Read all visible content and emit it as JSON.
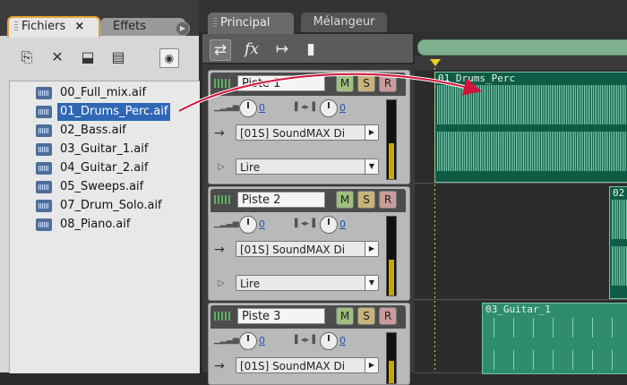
{
  "files_panel": {
    "tab_files": "Fichiers",
    "tab_effects": "Effets",
    "close_glyph": "×",
    "items": [
      {
        "name": "00_Full_mix.aif",
        "selected": false
      },
      {
        "name": "01_Drums_Perc.aif",
        "selected": true
      },
      {
        "name": "02_Bass.aif",
        "selected": false
      },
      {
        "name": "03_Guitar_1.aif",
        "selected": false
      },
      {
        "name": "04_Guitar_2.aif",
        "selected": false
      },
      {
        "name": "05_Sweeps.aif",
        "selected": false
      },
      {
        "name": "07_Drum_Solo.aif",
        "selected": false
      },
      {
        "name": "08_Piano.aif",
        "selected": false
      }
    ]
  },
  "main_tabs": {
    "principal": "Principal",
    "melangeur": "Mélangeur"
  },
  "toolbar": {
    "fx_label": "fx"
  },
  "tracks": [
    {
      "name": "Piste 1",
      "m": "M",
      "s": "S",
      "r": "R",
      "vol": "0",
      "pan": "0",
      "input": "[01S] SoundMAX Di",
      "mode": "Lire"
    },
    {
      "name": "Piste 2",
      "m": "M",
      "s": "S",
      "r": "R",
      "vol": "0",
      "pan": "0",
      "input": "[01S] SoundMAX Di",
      "mode": "Lire"
    },
    {
      "name": "Piste 3",
      "m": "M",
      "s": "S",
      "r": "R",
      "vol": "0",
      "pan": "0",
      "input": "[01S] SoundMAX Di",
      "mode": ""
    }
  ],
  "clips": [
    {
      "title": "01_Drums_Perc"
    },
    {
      "title": "02"
    },
    {
      "title": "03_Guitar_1"
    }
  ],
  "colors": {
    "accent": "#e5a23a",
    "selection": "#2f67b5",
    "clip": "#0f5b45",
    "wave": "#8ad3b8",
    "arrow": "#d2143c"
  }
}
